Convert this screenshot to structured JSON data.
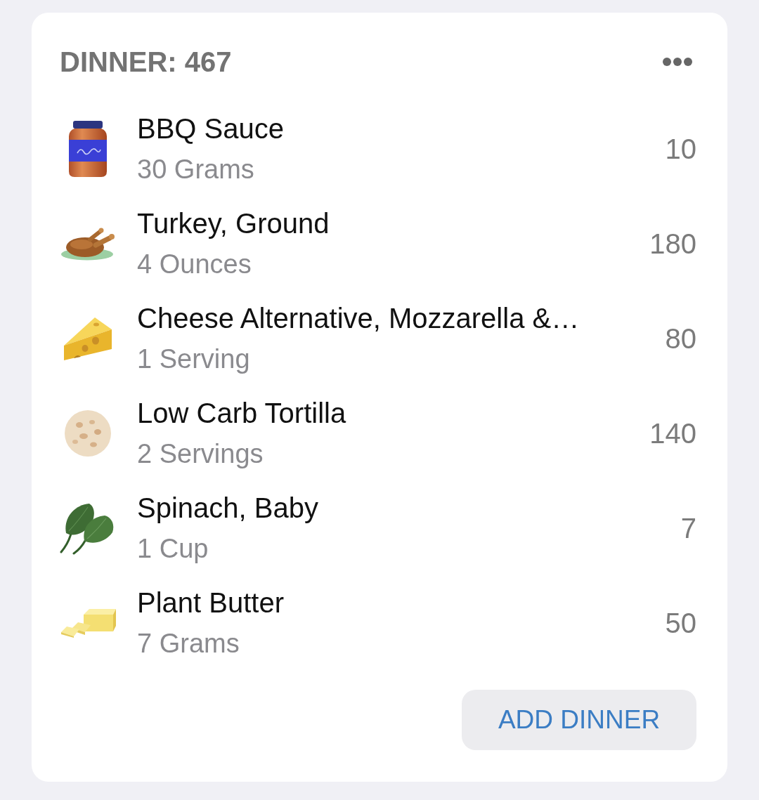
{
  "meal": {
    "title": "DINNER: 467"
  },
  "foods": [
    {
      "name": "BBQ Sauce",
      "amount": "30 Grams",
      "calories": "10"
    },
    {
      "name": "Turkey, Ground",
      "amount": "4 Ounces",
      "calories": "180"
    },
    {
      "name": "Cheese Alternative, Mozzarella &…",
      "amount": "1 Serving",
      "calories": "80"
    },
    {
      "name": "Low Carb Tortilla",
      "amount": "2 Servings",
      "calories": "140"
    },
    {
      "name": "Spinach, Baby",
      "amount": "1 Cup",
      "calories": "7"
    },
    {
      "name": "Plant Butter",
      "amount": "7 Grams",
      "calories": "50"
    }
  ],
  "add_button": {
    "label": "ADD DINNER"
  }
}
